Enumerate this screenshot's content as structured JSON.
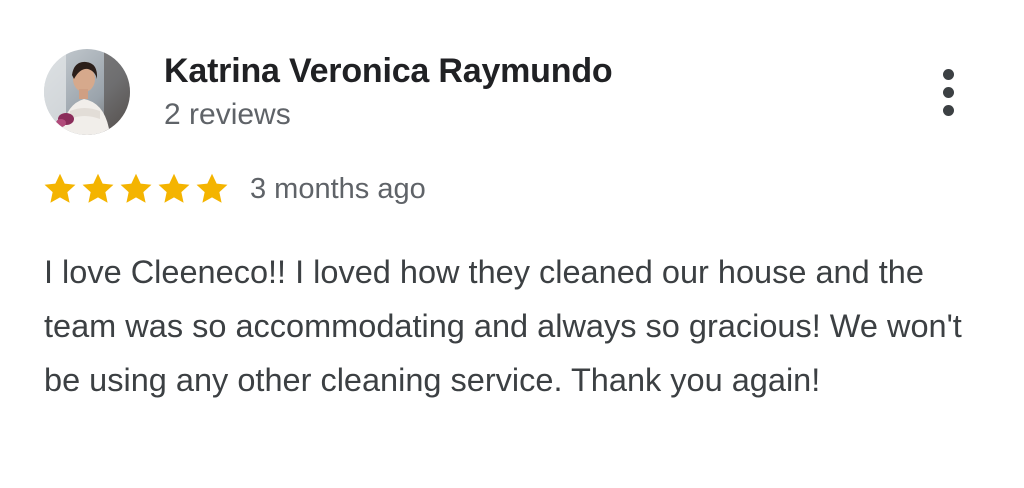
{
  "reviewer": {
    "name": "Katrina Veronica Raymundo",
    "review_count": "2 reviews",
    "avatar_icon": "profile-photo"
  },
  "menu": {
    "icon": "more-vertical-icon"
  },
  "rating": {
    "stars": 5,
    "max_stars": 5,
    "star_color": "#f4b400",
    "date": "3 months ago"
  },
  "review": {
    "text": "I love Cleeneco!! I loved how they cleaned our house and the team was so accommodating and always so gracious! We won't be using any other cleaning service. Thank you again!"
  }
}
